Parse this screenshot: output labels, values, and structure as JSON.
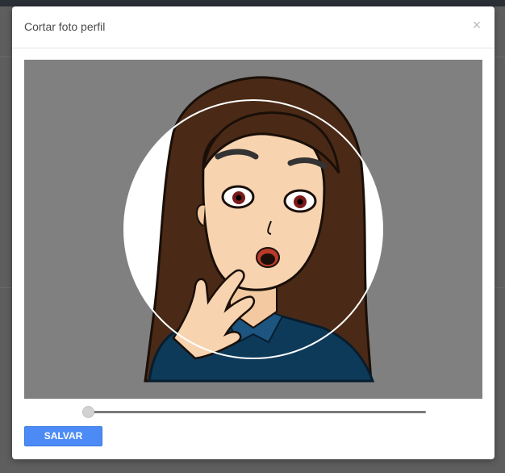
{
  "modal": {
    "title": "Cortar foto perfil",
    "close_symbol": "×",
    "save_label": "SALVAR"
  },
  "crop": {
    "zoom_level": 0,
    "image_subject": "cartoon-woman-surprised-avatar",
    "background_color": "#808080"
  },
  "colors": {
    "accent": "#4c8bf5",
    "topbar": "#2b2f36",
    "overlay": "#5e5e5e"
  },
  "icons": {
    "close": "close-icon"
  }
}
